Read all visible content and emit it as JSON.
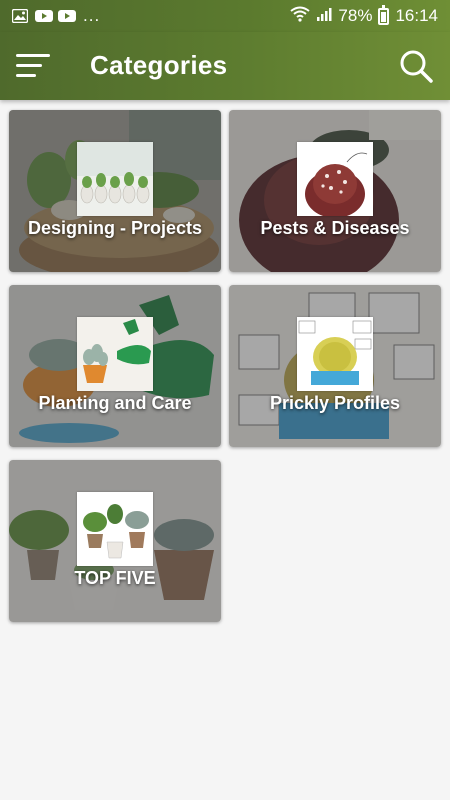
{
  "status_bar": {
    "battery": "78%",
    "time": "16:14",
    "overflow_dots": "...",
    "left_icons": [
      "image-icon",
      "youtube-icon",
      "youtube-icon"
    ],
    "right_icons": [
      "wifi-icon",
      "signal-icon",
      "battery-icon"
    ]
  },
  "app_bar": {
    "title": "Categories",
    "menu_icon": "hamburger-menu-icon",
    "search_icon": "search-icon"
  },
  "categories": [
    {
      "label": "Designing - Projects"
    },
    {
      "label": "Pests & Diseases"
    },
    {
      "label": "Planting and Care"
    },
    {
      "label": "Prickly Profiles"
    },
    {
      "label": "TOP FIVE"
    }
  ],
  "colors": {
    "app_bar": "#5b7a2e",
    "background": "#f5f5f5",
    "text_on_bar": "#ffffff"
  }
}
